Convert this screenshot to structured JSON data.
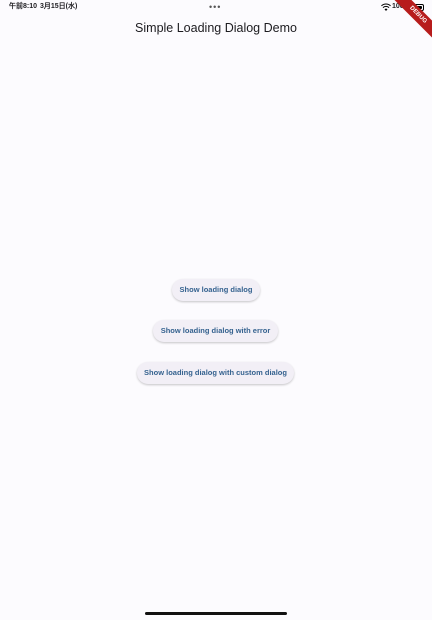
{
  "status_bar": {
    "time": "午前8:10",
    "date": "3月15日(水)",
    "dots": "•••",
    "battery_percent": "100%"
  },
  "debug_banner": "DEBUG",
  "app_bar": {
    "title": "Simple Loading Dialog Demo"
  },
  "buttons": [
    {
      "label": "Show loading dialog"
    },
    {
      "label": "Show loading dialog with error"
    },
    {
      "label": "Show loading dialog with custom dialog"
    }
  ],
  "colors": {
    "background": "#fcfbfe",
    "button_bg": "#f2eff6",
    "button_text": "#35628f",
    "debug_banner": "#b71c1c"
  }
}
